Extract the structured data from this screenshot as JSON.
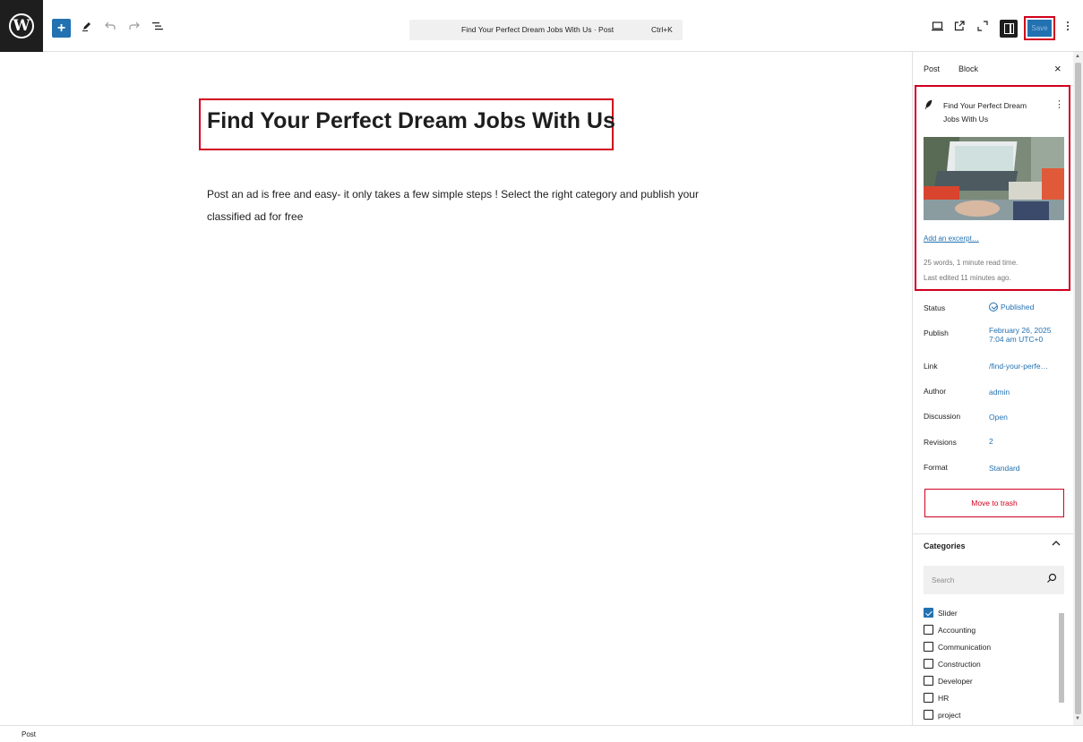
{
  "topbar": {
    "logo_glyph": "W",
    "inserter_glyph": "+",
    "tools_icon": "pencil-icon",
    "undo_icon": "undo-icon",
    "redo_icon": "redo-icon",
    "list_view_icon": "list-view-icon",
    "command_title": "Find Your Perfect Dream Jobs With Us · Post",
    "command_shortcut": "Ctrl+K",
    "view_icon": "desktop-icon",
    "preview_icon": "external-link-icon",
    "fullscreen_icon": "fullscreen-icon",
    "settings_icon": "settings-panel-icon",
    "save_label": "Save",
    "options_icon": "more-vertical-icon"
  },
  "editor": {
    "title": "Find Your Perfect Dream Jobs With Us",
    "body": "Post an ad is free and easy- it only takes a few simple steps ! Select the right category and publish your classified ad for free"
  },
  "sidebar": {
    "tab_post": "Post",
    "tab_block": "Block",
    "close_glyph": "×",
    "summary": {
      "post_title": "Find Your Perfect Dream Jobs With Us",
      "excerpt_link": "Add an excerpt…",
      "stats": "25 words, 1 minute read time.",
      "last_edited": "Last edited 11 minutes ago."
    },
    "rows": {
      "status_label": "Status",
      "status_value": "Published",
      "publish_label": "Publish",
      "publish_value_line1": "February 26, 2025",
      "publish_value_line2": "7:04 am UTC+0",
      "link_label": "Link",
      "link_value": "/find-your-perfe…",
      "author_label": "Author",
      "author_value": "admin",
      "discussion_label": "Discussion",
      "discussion_value": "Open",
      "revisions_label": "Revisions",
      "revisions_value": "2",
      "format_label": "Format",
      "format_value": "Standard"
    },
    "trash_label": "Move to trash",
    "categories": {
      "title": "Categories",
      "search_placeholder": "Search",
      "items": [
        {
          "label": "Slider",
          "checked": true
        },
        {
          "label": "Accounting",
          "checked": false
        },
        {
          "label": "Communication",
          "checked": false
        },
        {
          "label": "Construction",
          "checked": false
        },
        {
          "label": "Developer",
          "checked": false
        },
        {
          "label": "HR",
          "checked": false
        },
        {
          "label": "project",
          "checked": false
        }
      ]
    }
  },
  "footer": {
    "breadcrumb": "Post"
  },
  "colors": {
    "accent": "#2271b1",
    "highlight": "#d1001f",
    "dark": "#1e1e1e"
  }
}
